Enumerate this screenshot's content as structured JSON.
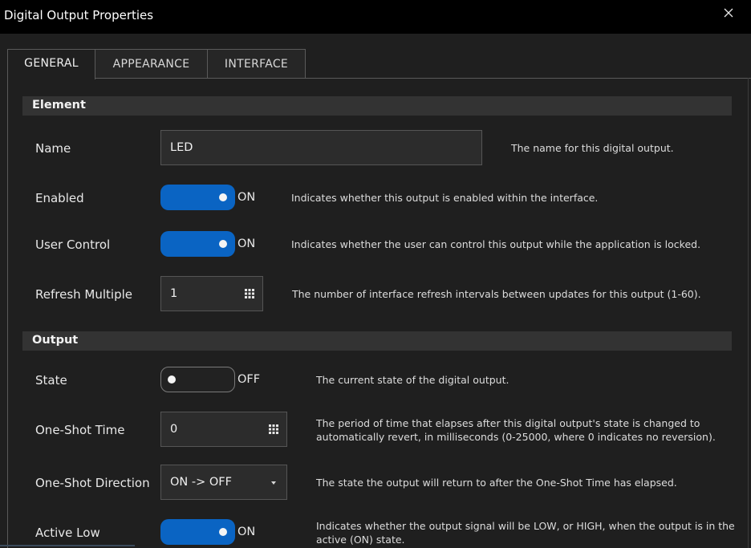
{
  "window": {
    "title": "Digital Output Properties",
    "close_icon": "close-icon"
  },
  "tabs": [
    {
      "label": "GENERAL",
      "active": true
    },
    {
      "label": "APPEARANCE",
      "active": false
    },
    {
      "label": "INTERFACE",
      "active": false
    }
  ],
  "element_section": {
    "heading": "Element",
    "name": {
      "label": "Name",
      "value": "LED",
      "desc": "The name for this digital output."
    },
    "enabled": {
      "label": "Enabled",
      "state": "ON",
      "desc": "Indicates whether this output is enabled within the interface."
    },
    "user_control": {
      "label": "User Control",
      "state": "ON",
      "desc": "Indicates whether the user can control this output while the application is locked."
    },
    "refresh_multiple": {
      "label": "Refresh Multiple",
      "value": "1",
      "desc": "The number of interface refresh intervals between updates for this output (1-60)."
    }
  },
  "output_section": {
    "heading": "Output",
    "state": {
      "label": "State",
      "state": "OFF",
      "desc": "The current state of the digital output."
    },
    "one_shot_time": {
      "label": "One-Shot Time",
      "value": "0",
      "desc_line1": "The period of time that elapses after this digital output's state is changed to",
      "desc_line2": "automatically revert, in milliseconds (0-25000, where 0 indicates no reversion)."
    },
    "one_shot_direction": {
      "label": "One-Shot Direction",
      "value": "ON -> OFF",
      "desc": "The state the output will return to after the One-Shot Time has elapsed."
    },
    "active_low": {
      "label": "Active Low",
      "state": "ON",
      "desc_line1": "Indicates whether the output signal will be LOW, or HIGH, when the output is in the",
      "desc_line2": "active (ON) state."
    }
  },
  "colors": {
    "accent": "#0a64c3",
    "background": "#1f1f1f",
    "titlebar": "#000000",
    "section": "#333333"
  }
}
